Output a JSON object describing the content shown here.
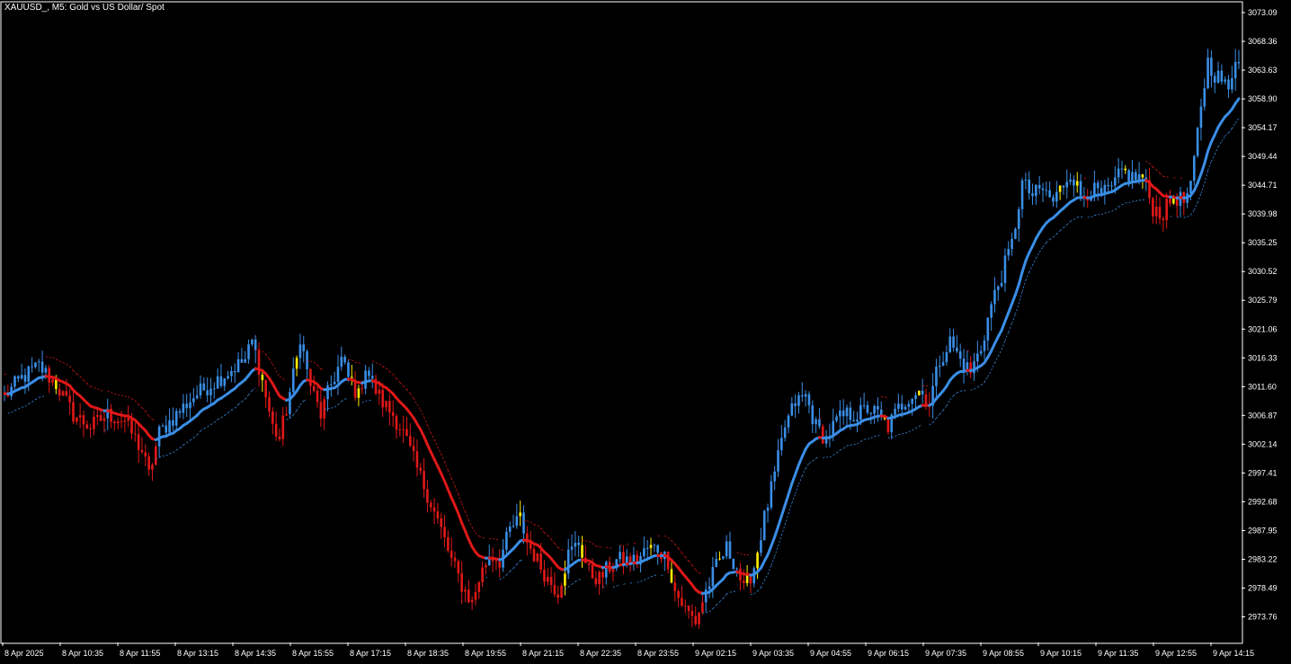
{
  "window": {
    "symbol": "XAUUSD_",
    "timeframe": "M5",
    "description": "Gold vs US Dollar/ Spot",
    "title_text": "XAUUSD_, M5:  Gold vs US Dollar/ Spot"
  },
  "colors": {
    "background": "#000000",
    "frame": "#ffffff",
    "bull": "#3a8ee6",
    "bear": "#e01818",
    "neutral": "#ffee00",
    "ma_up": "#3a8ee6",
    "ma_down": "#e01818",
    "band_up": "#3a8ee6",
    "band_down": "#e01818"
  },
  "chart_data": {
    "type": "candlestick",
    "ylim": [
      2971.0,
      3075.0
    ],
    "y_ticks": [
      "3073.09",
      "3068.36",
      "3063.63",
      "3058.90",
      "3054.17",
      "3049.44",
      "3044.71",
      "3039.98",
      "3035.25",
      "3030.52",
      "3025.79",
      "3021.06",
      "3016.33",
      "3011.60",
      "3006.87",
      "3002.14",
      "2997.41",
      "2992.68",
      "2987.95",
      "2983.22",
      "2978.49",
      "2973.76"
    ],
    "x_ticks": [
      "8 Apr 2025",
      "8 Apr 10:35",
      "8 Apr 11:55",
      "8 Apr 13:15",
      "8 Apr 14:35",
      "8 Apr 15:55",
      "8 Apr 17:15",
      "8 Apr 18:35",
      "8 Apr 19:55",
      "8 Apr 21:15",
      "8 Apr 22:35",
      "8 Apr 23:55",
      "9 Apr 02:15",
      "9 Apr 03:35",
      "9 Apr 04:55",
      "9 Apr 06:15",
      "9 Apr 07:35",
      "9 Apr 08:55",
      "9 Apr 10:15",
      "9 Apr 11:35",
      "9 Apr 12:55",
      "9 Apr 14:15"
    ],
    "close_path": [
      [
        0,
        3010
      ],
      [
        5,
        3013
      ],
      [
        10,
        3015
      ],
      [
        15,
        3012
      ],
      [
        20,
        3007
      ],
      [
        25,
        3005
      ],
      [
        30,
        3007
      ],
      [
        35,
        3006
      ],
      [
        40,
        3001
      ],
      [
        42,
        2997
      ],
      [
        45,
        3004
      ],
      [
        50,
        3007
      ],
      [
        55,
        3010
      ],
      [
        60,
        3012
      ],
      [
        65,
        3014
      ],
      [
        70,
        3016
      ],
      [
        72,
        3019
      ],
      [
        74,
        3015
      ],
      [
        76,
        3010
      ],
      [
        78,
        3005
      ],
      [
        80,
        3003
      ],
      [
        82,
        3008
      ],
      [
        85,
        3016
      ],
      [
        86,
        3020
      ],
      [
        88,
        3014
      ],
      [
        90,
        3010
      ],
      [
        92,
        3007
      ],
      [
        95,
        3012
      ],
      [
        98,
        3016
      ],
      [
        100,
        3013
      ],
      [
        103,
        3010
      ],
      [
        105,
        3015
      ],
      [
        107,
        3012
      ],
      [
        110,
        3009
      ],
      [
        113,
        3007
      ],
      [
        116,
        3004
      ],
      [
        120,
        2998
      ],
      [
        123,
        2994
      ],
      [
        127,
        2988
      ],
      [
        130,
        2983
      ],
      [
        133,
        2979
      ],
      [
        136,
        2976
      ],
      [
        138,
        2980
      ],
      [
        141,
        2984
      ],
      [
        144,
        2983
      ],
      [
        147,
        2988
      ],
      [
        150,
        2990
      ],
      [
        152,
        2986
      ],
      [
        155,
        2983
      ],
      [
        158,
        2980
      ],
      [
        161,
        2978
      ],
      [
        164,
        2984
      ],
      [
        167,
        2986
      ],
      [
        170,
        2981
      ],
      [
        173,
        2980
      ],
      [
        176,
        2982
      ],
      [
        178,
        2983
      ],
      [
        181,
        2983
      ],
      [
        184,
        2983
      ],
      [
        187,
        2985
      ],
      [
        190,
        2985
      ],
      [
        193,
        2983
      ],
      [
        195,
        2978
      ],
      [
        198,
        2975
      ],
      [
        201,
        2973
      ],
      [
        204,
        2978
      ],
      [
        207,
        2982
      ],
      [
        210,
        2985
      ],
      [
        213,
        2982
      ],
      [
        215,
        2978
      ],
      [
        218,
        2982
      ],
      [
        221,
        2990
      ],
      [
        224,
        2997
      ],
      [
        227,
        3005
      ],
      [
        230,
        3009
      ],
      [
        233,
        3010
      ],
      [
        236,
        3005
      ],
      [
        239,
        3003
      ],
      [
        242,
        3006
      ],
      [
        245,
        3007
      ],
      [
        248,
        3007
      ],
      [
        251,
        3008
      ],
      [
        254,
        3007
      ],
      [
        257,
        3005
      ],
      [
        260,
        3008
      ],
      [
        263,
        3010
      ],
      [
        266,
        3011
      ],
      [
        269,
        3009
      ],
      [
        272,
        3016
      ],
      [
        275,
        3019
      ],
      [
        278,
        3016
      ],
      [
        281,
        3014
      ],
      [
        284,
        3018
      ],
      [
        287,
        3025
      ],
      [
        290,
        3030
      ],
      [
        293,
        3035
      ],
      [
        296,
        3045
      ],
      [
        299,
        3043
      ],
      [
        302,
        3044
      ],
      [
        305,
        3042
      ],
      [
        308,
        3045
      ],
      [
        310,
        3047
      ],
      [
        313,
        3043
      ],
      [
        316,
        3044
      ],
      [
        319,
        3043
      ],
      [
        322,
        3044
      ],
      [
        325,
        3047
      ],
      [
        328,
        3046
      ],
      [
        331,
        3046
      ],
      [
        334,
        3041
      ],
      [
        337,
        3040
      ],
      [
        340,
        3043
      ],
      [
        343,
        3042
      ],
      [
        345,
        3044
      ],
      [
        348,
        3058
      ],
      [
        350,
        3065
      ],
      [
        352,
        3063
      ],
      [
        354,
        3062
      ],
      [
        356,
        3060
      ],
      [
        358,
        3066
      ]
    ],
    "neutral_bars": [
      15,
      75,
      85,
      101,
      103,
      150,
      163,
      168,
      188,
      194,
      208,
      216,
      219,
      256,
      266,
      307,
      312,
      326,
      331,
      340
    ]
  }
}
